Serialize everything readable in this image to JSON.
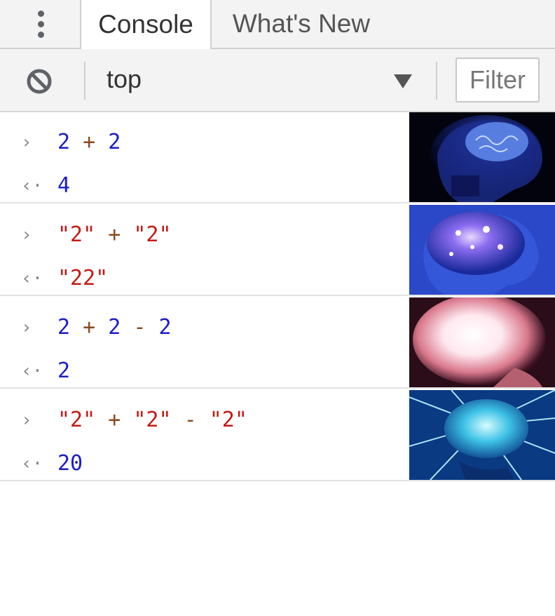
{
  "tabs": [
    {
      "label": "Console",
      "active": true
    },
    {
      "label": "What's New",
      "active": false
    }
  ],
  "toolbar": {
    "context": "top",
    "filter_placeholder": "Filter"
  },
  "prompts": {
    "input": "›",
    "output": "‹·"
  },
  "entries": [
    {
      "input": [
        "2",
        " + ",
        "2"
      ],
      "output": "4",
      "brain": "dark-blue-brain"
    },
    {
      "input": [
        "\"2\"",
        " + ",
        "\"2\""
      ],
      "output": "\"22\"",
      "brain": "glowing-blue-brain"
    },
    {
      "input": [
        "2",
        " + ",
        "2",
        " - ",
        "2"
      ],
      "output": "2",
      "brain": "radiant-brain"
    },
    {
      "input": [
        "\"2\"",
        " + ",
        "\"2\"",
        " - ",
        "\"2\""
      ],
      "output": "20",
      "brain": "cosmic-brain"
    }
  ],
  "colors": {
    "number": "#1c1cc8",
    "string": "#c41a16",
    "operator": "#8a4a1c"
  }
}
